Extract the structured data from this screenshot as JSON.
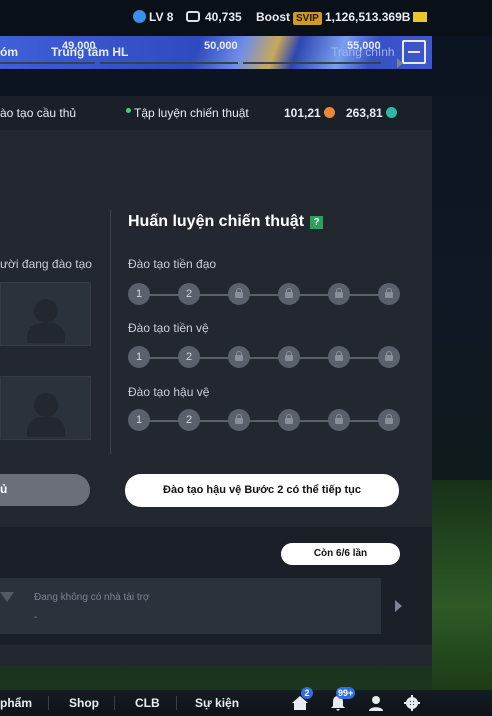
{
  "topbar": {
    "level": "LV 8",
    "coins": "40,735",
    "boost_label": "Boost",
    "svip": "SVIP",
    "bp": "1,126,513.369B"
  },
  "nav": {
    "left_partial": "óm",
    "training_center": "Trung tâm HL",
    "right_partial": "Trang chính"
  },
  "tabs": {
    "player_training_partial": "ào tạo cầu thủ",
    "tactical_practice": "Tập luyện chiến thuật",
    "currency1": "101,21",
    "currency2": "263,81"
  },
  "progress": {
    "values": [
      "49,000",
      "50,000",
      "55,000"
    ]
  },
  "tactical": {
    "title": "Huấn luyện chiến thuật",
    "help_icon": "?",
    "rows": [
      {
        "label": "Đào tạo tiền đạo",
        "n1": "1",
        "n2": "2"
      },
      {
        "label": "Đào tạo tiền vệ",
        "n1": "1",
        "n2": "2"
      },
      {
        "label": "Đào tạo hậu vệ",
        "n1": "1",
        "n2": "2"
      }
    ],
    "continue_button": "Đào tạo hậu vệ Bước 2 có thể tiếp tục"
  },
  "left": {
    "training_label_partial": "ười đang đào tạo",
    "button_partial": "ủ"
  },
  "remaining": "Còn 6/6 lần",
  "sponsor": {
    "text": "Đang không có nhà tài trợ",
    "dash": "-"
  },
  "bottom": {
    "products_partial": "phẩm",
    "shop": "Shop",
    "club": "CLB",
    "events": "Sự kiện",
    "home_badge": "2",
    "notif_badge": "99+"
  },
  "colors": {
    "accent_blue": "#3f5fd8",
    "green_dot": "#37d67a",
    "gold": "#e8c72c"
  }
}
